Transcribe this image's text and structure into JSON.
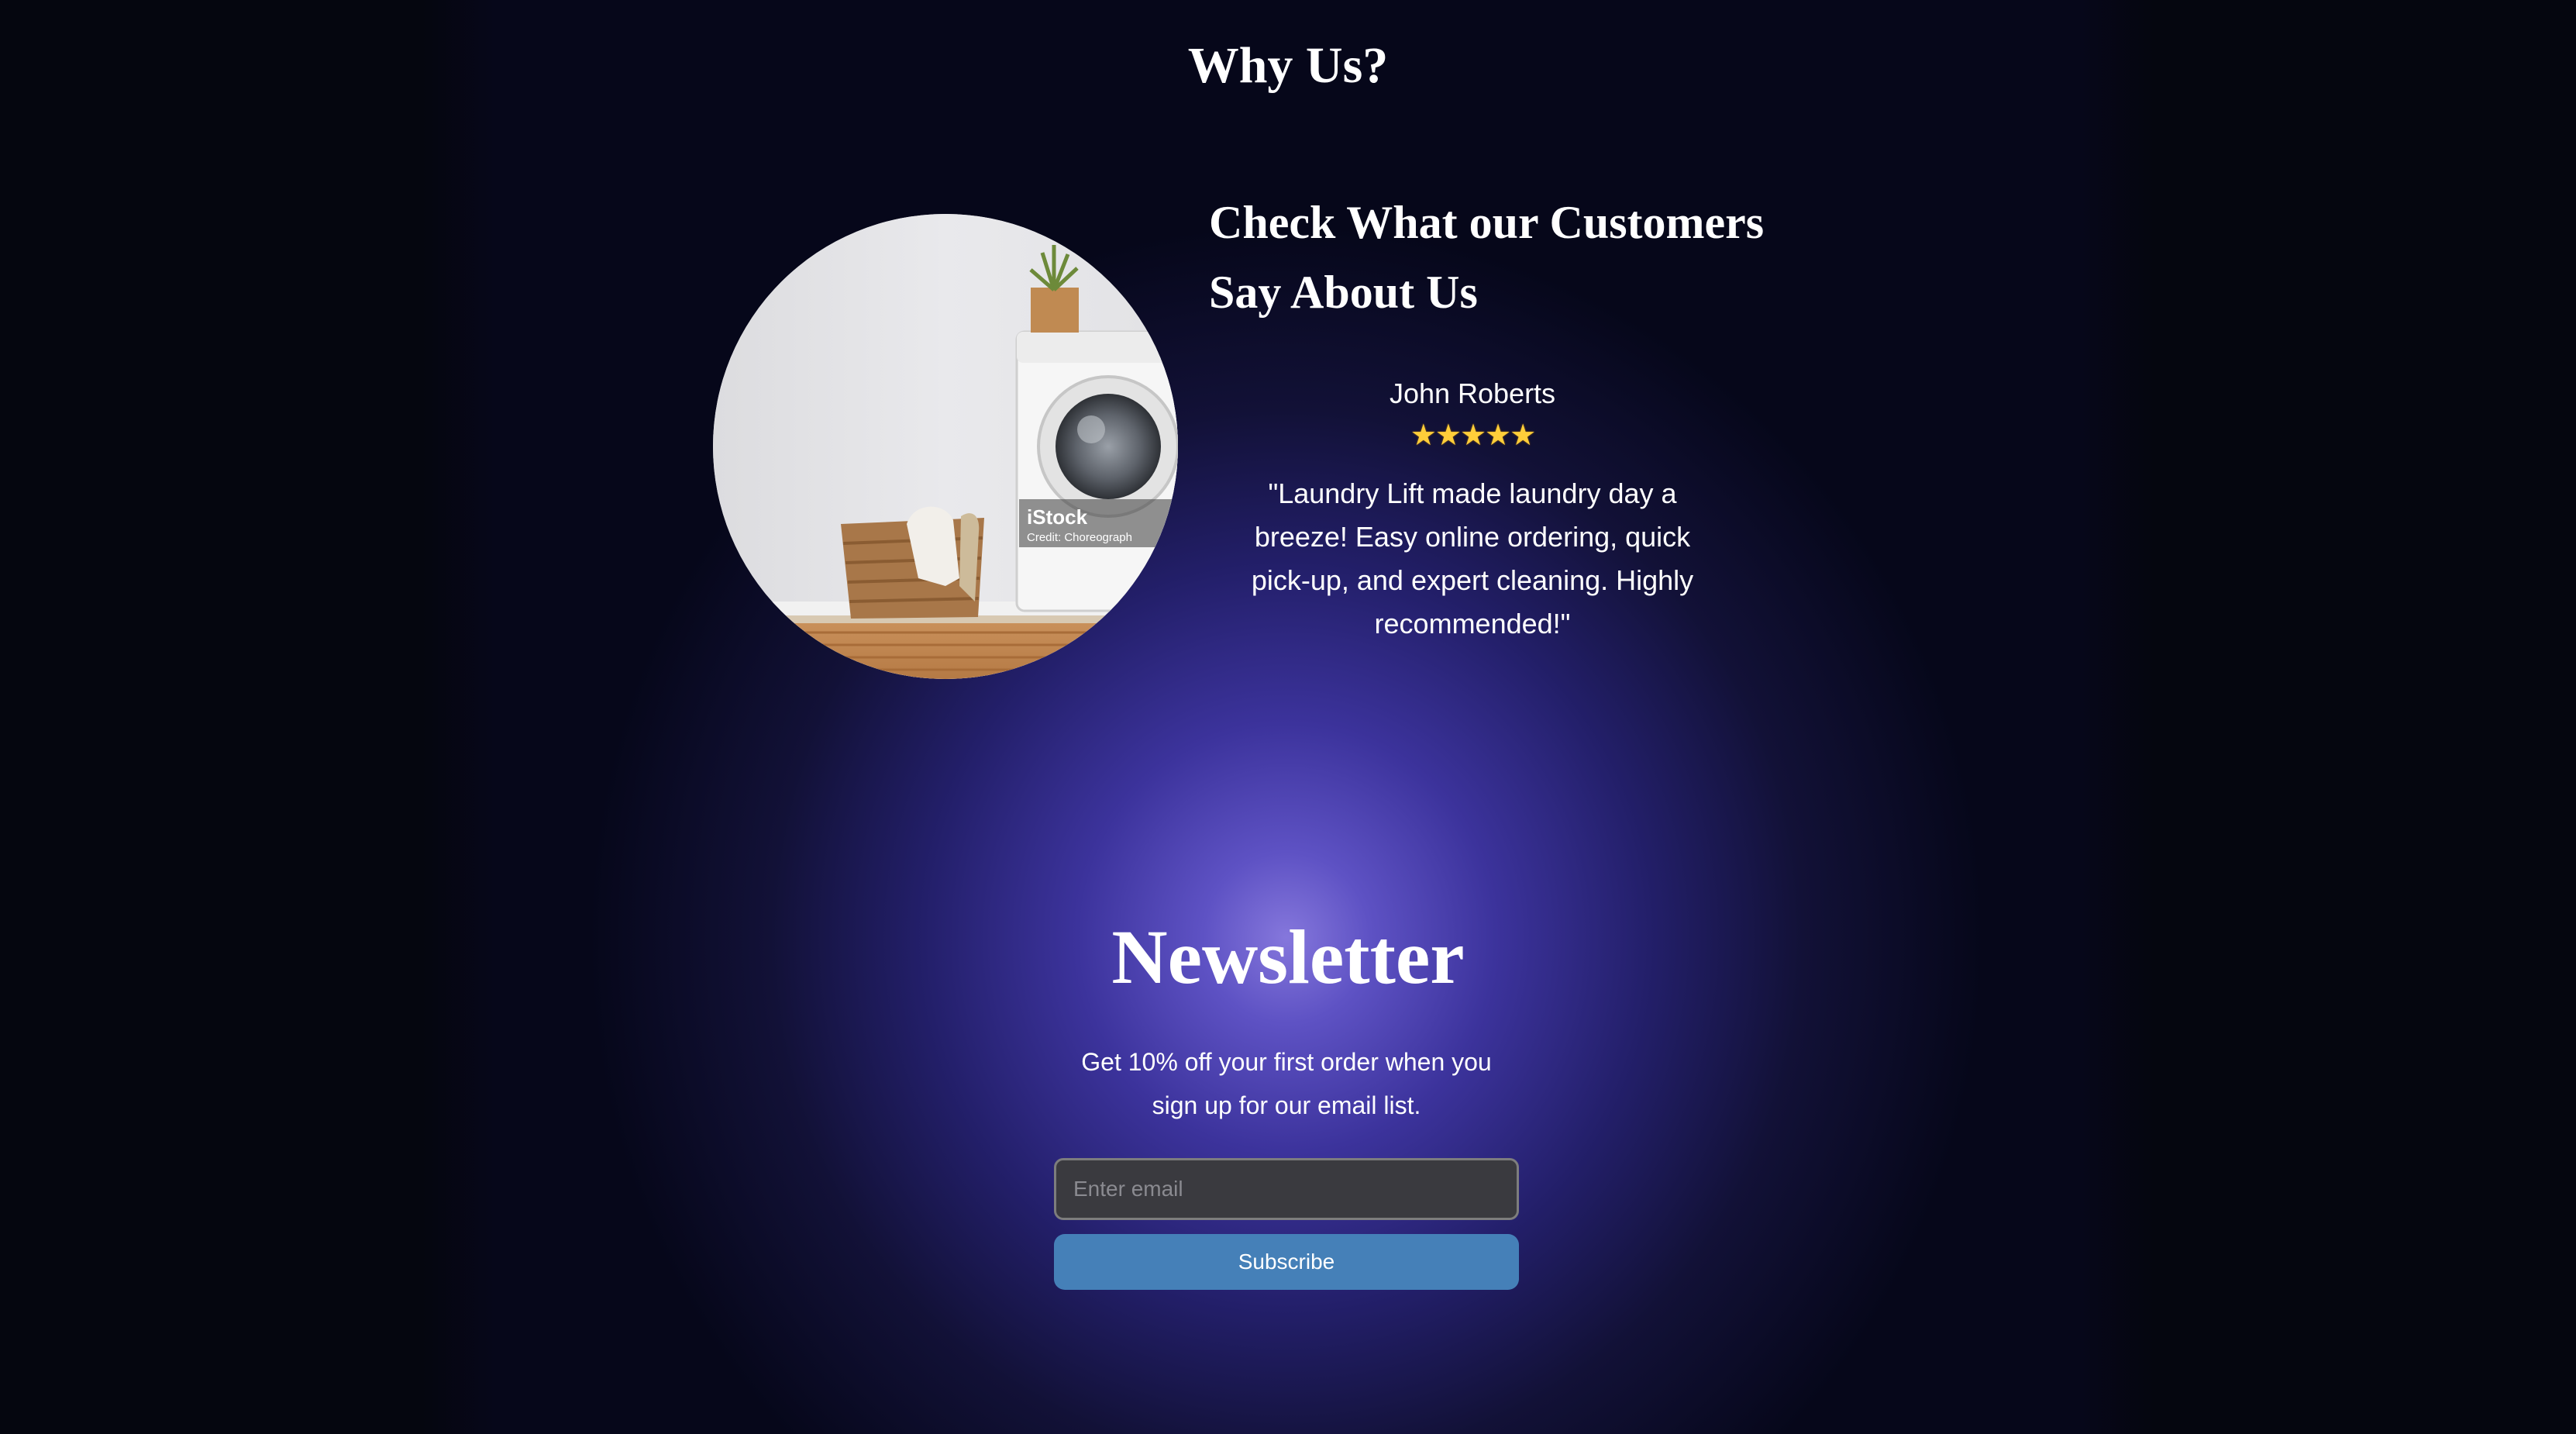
{
  "why_us": {
    "title": "Why Us?"
  },
  "testimonial": {
    "heading": "Check What our Customers Say About Us",
    "image_alt": "Laundry room with washing machine and basket",
    "image_watermark": "iStock",
    "image_credit": "Credit: Choreograph",
    "reviewer_name": "John Roberts",
    "rating": 5,
    "review_text": "\"Laundry Lift made laundry day a breeze! Easy online ordering, quick pick-up, and expert cleaning. Highly recommended!\""
  },
  "newsletter": {
    "title": "Newsletter",
    "description": "Get 10% off your first order when you sign up for our email list.",
    "email_placeholder": "Enter email",
    "email_value": "",
    "subscribe_label": "Subscribe"
  },
  "colors": {
    "glow_center": "#8577dc",
    "background_dark": "#05060f",
    "button_blue": "#4580b8",
    "input_bg": "#3a3a3f",
    "star_gold": "#ffce3a"
  }
}
